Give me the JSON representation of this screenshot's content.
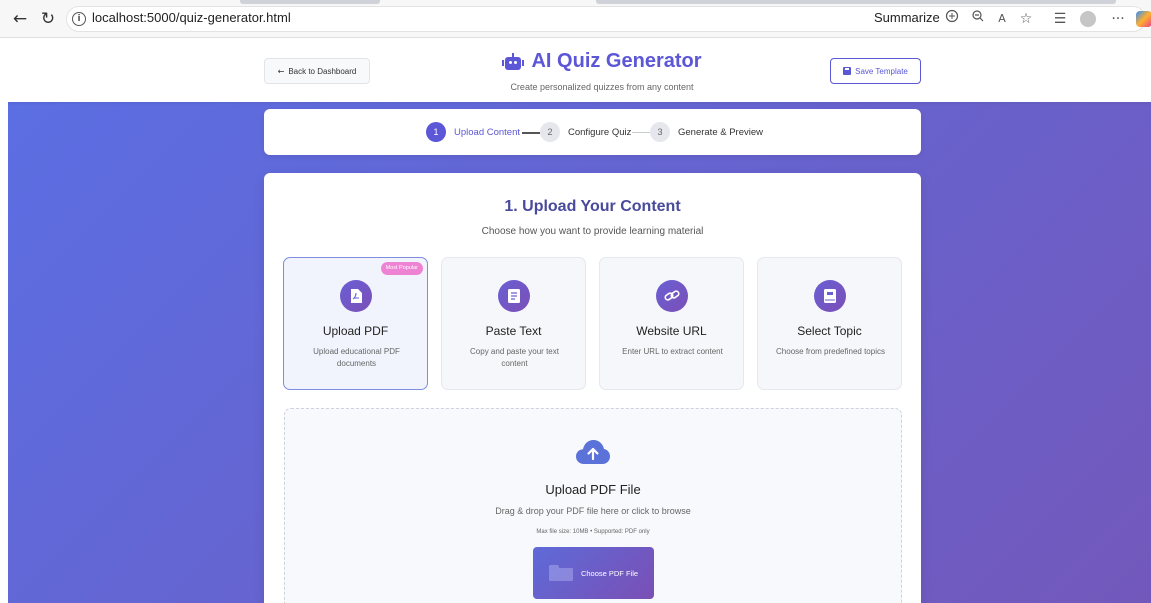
{
  "browser": {
    "url": "localhost:5000/quiz-generator.html",
    "summarize_label": "Summarize",
    "back_glyph": "←",
    "reload_glyph": "↻",
    "info_glyph": "i",
    "more_glyph": "···"
  },
  "header": {
    "back_label": "Back to Dashboard",
    "back_arrow": "←",
    "title": "AI Quiz Generator",
    "subtitle": "Create personalized quizzes from any content",
    "save_label": "Save Template"
  },
  "stepper": {
    "steps": [
      {
        "number": "1",
        "label": "Upload Content",
        "active": true
      },
      {
        "number": "2",
        "label": "Configure Quiz",
        "active": false
      },
      {
        "number": "3",
        "label": "Generate & Preview",
        "active": false
      }
    ]
  },
  "section": {
    "title": "1. Upload Your Content",
    "subtitle": "Choose how you want to provide learning material"
  },
  "options": [
    {
      "title": "Upload PDF",
      "description": "Upload educational PDF documents",
      "icon": "pdf-file-icon",
      "badge": "Most Popular",
      "selected": true
    },
    {
      "title": "Paste Text",
      "description": "Copy and paste your text content",
      "icon": "text-lines-icon",
      "selected": false
    },
    {
      "title": "Website URL",
      "description": "Enter URL to extract content",
      "icon": "link-icon",
      "selected": false
    },
    {
      "title": "Select Topic",
      "description": "Choose from predefined topics",
      "icon": "book-icon",
      "selected": false
    }
  ],
  "upload": {
    "title": "Upload PDF File",
    "subtitle": "Drag & drop your PDF file here or click to browse",
    "note": "Max file size: 10MB • Supported: PDF only",
    "button_label": "Choose PDF File"
  },
  "colors": {
    "accent": "#5b57d6",
    "gradient_start": "#5a6fe4",
    "gradient_end": "#7358bb",
    "badge": "#ee82d3"
  }
}
